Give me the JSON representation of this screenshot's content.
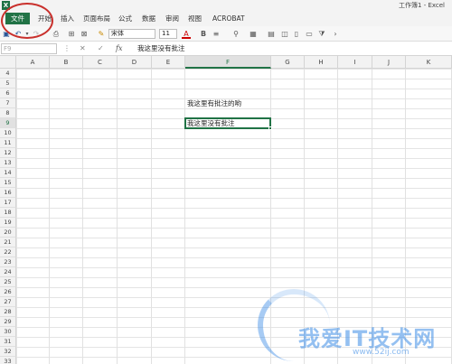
{
  "window": {
    "title": "工作簿1 - Excel",
    "app_icon": "X"
  },
  "ribbon": {
    "tabs": [
      "文件",
      "开始",
      "插入",
      "页面布局",
      "公式",
      "数据",
      "审阅",
      "视图",
      "ACROBAT"
    ]
  },
  "toolbar": {
    "font_name": "宋体",
    "font_size": "11",
    "bold": "B",
    "font_color_letter": "A"
  },
  "formula_bar": {
    "name_box": "F9",
    "fx": "fx",
    "content": "我这里没有批注"
  },
  "grid": {
    "columns": [
      "A",
      "B",
      "C",
      "D",
      "E",
      "F",
      "G",
      "H",
      "I",
      "J",
      "K"
    ],
    "active_column": "F",
    "rows": [
      "4",
      "5",
      "6",
      "7",
      "8",
      "9",
      "10",
      "11",
      "12",
      "13",
      "14",
      "15",
      "16",
      "17",
      "18",
      "19",
      "20",
      "21",
      "22",
      "23",
      "24",
      "25",
      "26",
      "27",
      "28",
      "29",
      "30",
      "31",
      "32",
      "33"
    ],
    "active_row": "9",
    "cells": [
      {
        "ref": "F7",
        "text": "我这里有批注的哟"
      },
      {
        "ref": "F9",
        "text": "我这里没有批注"
      }
    ]
  },
  "watermark": {
    "text": "我爱IT技术网",
    "sub": "www.52ij.com"
  },
  "colors": {
    "excel_green": "#217346",
    "annotation_red": "#c9302c"
  }
}
